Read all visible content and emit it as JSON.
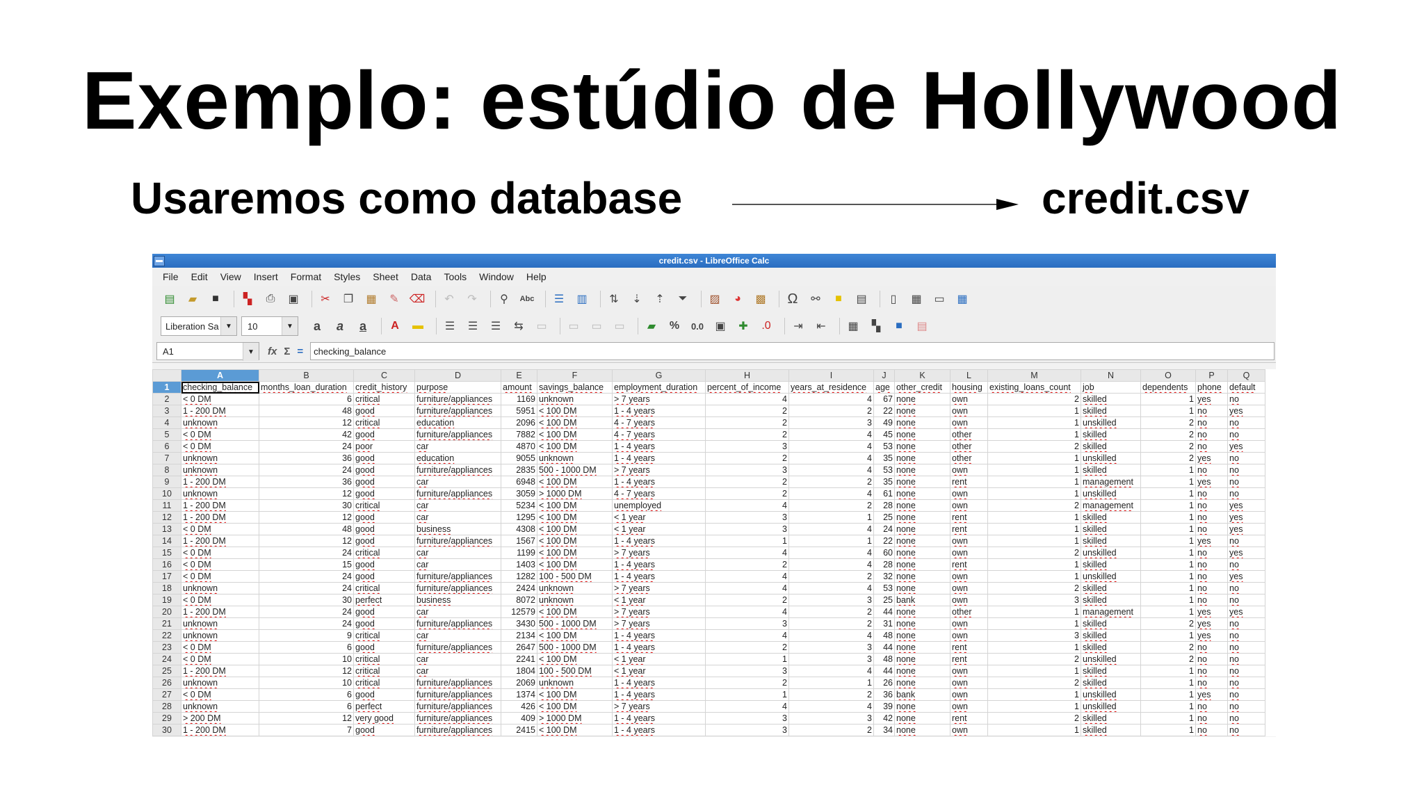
{
  "slide": {
    "title": "Exemplo: estúdio de Hollywood",
    "subtitle_left": "Usaremos como database",
    "subtitle_right": "credit.csv"
  },
  "window": {
    "title": "credit.csv - LibreOffice Calc"
  },
  "menu": [
    "File",
    "Edit",
    "View",
    "Insert",
    "Format",
    "Styles",
    "Sheet",
    "Data",
    "Tools",
    "Window",
    "Help"
  ],
  "toolbar": {
    "font_name": "Liberation Sa",
    "font_size": "10",
    "cell_ref": "A1",
    "formula": "checking_balance",
    "fx_label": "fx"
  },
  "columns": [
    "A",
    "B",
    "C",
    "D",
    "E",
    "F",
    "G",
    "H",
    "I",
    "J",
    "K",
    "L",
    "M",
    "N",
    "O",
    "P",
    "Q"
  ],
  "headers": [
    "checking_balance",
    "months_loan_duration",
    "credit_history",
    "purpose",
    "amount",
    "savings_balance",
    "employment_duration",
    "percent_of_income",
    "years_at_residence",
    "age",
    "other_credit",
    "housing",
    "existing_loans_count",
    "job",
    "dependents",
    "phone",
    "default"
  ],
  "rows": [
    [
      "< 0 DM",
      "6",
      "critical",
      "furniture/appliances",
      "1169",
      "unknown",
      "> 7 years",
      "4",
      "4",
      "67",
      "none",
      "own",
      "2",
      "skilled",
      "1",
      "yes",
      "no"
    ],
    [
      "1 - 200 DM",
      "48",
      "good",
      "furniture/appliances",
      "5951",
      "< 100 DM",
      "1 - 4 years",
      "2",
      "2",
      "22",
      "none",
      "own",
      "1",
      "skilled",
      "1",
      "no",
      "yes"
    ],
    [
      "unknown",
      "12",
      "critical",
      "education",
      "2096",
      "< 100 DM",
      "4 - 7 years",
      "2",
      "3",
      "49",
      "none",
      "own",
      "1",
      "unskilled",
      "2",
      "no",
      "no"
    ],
    [
      "< 0 DM",
      "42",
      "good",
      "furniture/appliances",
      "7882",
      "< 100 DM",
      "4 - 7 years",
      "2",
      "4",
      "45",
      "none",
      "other",
      "1",
      "skilled",
      "2",
      "no",
      "no"
    ],
    [
      "< 0 DM",
      "24",
      "poor",
      "car",
      "4870",
      "< 100 DM",
      "1 - 4 years",
      "3",
      "4",
      "53",
      "none",
      "other",
      "2",
      "skilled",
      "2",
      "no",
      "yes"
    ],
    [
      "unknown",
      "36",
      "good",
      "education",
      "9055",
      "unknown",
      "1 - 4 years",
      "2",
      "4",
      "35",
      "none",
      "other",
      "1",
      "unskilled",
      "2",
      "yes",
      "no"
    ],
    [
      "unknown",
      "24",
      "good",
      "furniture/appliances",
      "2835",
      "500 - 1000 DM",
      "> 7 years",
      "3",
      "4",
      "53",
      "none",
      "own",
      "1",
      "skilled",
      "1",
      "no",
      "no"
    ],
    [
      "1 - 200 DM",
      "36",
      "good",
      "car",
      "6948",
      "< 100 DM",
      "1 - 4 years",
      "2",
      "2",
      "35",
      "none",
      "rent",
      "1",
      "management",
      "1",
      "yes",
      "no"
    ],
    [
      "unknown",
      "12",
      "good",
      "furniture/appliances",
      "3059",
      "> 1000 DM",
      "4 - 7 years",
      "2",
      "4",
      "61",
      "none",
      "own",
      "1",
      "unskilled",
      "1",
      "no",
      "no"
    ],
    [
      "1 - 200 DM",
      "30",
      "critical",
      "car",
      "5234",
      "< 100 DM",
      "unemployed",
      "4",
      "2",
      "28",
      "none",
      "own",
      "2",
      "management",
      "1",
      "no",
      "yes"
    ],
    [
      "1 - 200 DM",
      "12",
      "good",
      "car",
      "1295",
      "< 100 DM",
      "< 1 year",
      "3",
      "1",
      "25",
      "none",
      "rent",
      "1",
      "skilled",
      "1",
      "no",
      "yes"
    ],
    [
      "< 0 DM",
      "48",
      "good",
      "business",
      "4308",
      "< 100 DM",
      "< 1 year",
      "3",
      "4",
      "24",
      "none",
      "rent",
      "1",
      "skilled",
      "1",
      "no",
      "yes"
    ],
    [
      "1 - 200 DM",
      "12",
      "good",
      "furniture/appliances",
      "1567",
      "< 100 DM",
      "1 - 4 years",
      "1",
      "1",
      "22",
      "none",
      "own",
      "1",
      "skilled",
      "1",
      "yes",
      "no"
    ],
    [
      "< 0 DM",
      "24",
      "critical",
      "car",
      "1199",
      "< 100 DM",
      "> 7 years",
      "4",
      "4",
      "60",
      "none",
      "own",
      "2",
      "unskilled",
      "1",
      "no",
      "yes"
    ],
    [
      "< 0 DM",
      "15",
      "good",
      "car",
      "1403",
      "< 100 DM",
      "1 - 4 years",
      "2",
      "4",
      "28",
      "none",
      "rent",
      "1",
      "skilled",
      "1",
      "no",
      "no"
    ],
    [
      "< 0 DM",
      "24",
      "good",
      "furniture/appliances",
      "1282",
      "100 - 500 DM",
      "1 - 4 years",
      "4",
      "2",
      "32",
      "none",
      "own",
      "1",
      "unskilled",
      "1",
      "no",
      "yes"
    ],
    [
      "unknown",
      "24",
      "critical",
      "furniture/appliances",
      "2424",
      "unknown",
      "> 7 years",
      "4",
      "4",
      "53",
      "none",
      "own",
      "2",
      "skilled",
      "1",
      "no",
      "no"
    ],
    [
      "< 0 DM",
      "30",
      "perfect",
      "business",
      "8072",
      "unknown",
      "< 1 year",
      "2",
      "3",
      "25",
      "bank",
      "own",
      "3",
      "skilled",
      "1",
      "no",
      "no"
    ],
    [
      "1 - 200 DM",
      "24",
      "good",
      "car",
      "12579",
      "< 100 DM",
      "> 7 years",
      "4",
      "2",
      "44",
      "none",
      "other",
      "1",
      "management",
      "1",
      "yes",
      "yes"
    ],
    [
      "unknown",
      "24",
      "good",
      "furniture/appliances",
      "3430",
      "500 - 1000 DM",
      "> 7 years",
      "3",
      "2",
      "31",
      "none",
      "own",
      "1",
      "skilled",
      "2",
      "yes",
      "no"
    ],
    [
      "unknown",
      "9",
      "critical",
      "car",
      "2134",
      "< 100 DM",
      "1 - 4 years",
      "4",
      "4",
      "48",
      "none",
      "own",
      "3",
      "skilled",
      "1",
      "yes",
      "no"
    ],
    [
      "< 0 DM",
      "6",
      "good",
      "furniture/appliances",
      "2647",
      "500 - 1000 DM",
      "1 - 4 years",
      "2",
      "3",
      "44",
      "none",
      "rent",
      "1",
      "skilled",
      "2",
      "no",
      "no"
    ],
    [
      "< 0 DM",
      "10",
      "critical",
      "car",
      "2241",
      "< 100 DM",
      "< 1 year",
      "1",
      "3",
      "48",
      "none",
      "rent",
      "2",
      "unskilled",
      "2",
      "no",
      "no"
    ],
    [
      "1 - 200 DM",
      "12",
      "critical",
      "car",
      "1804",
      "100 - 500 DM",
      "< 1 year",
      "3",
      "4",
      "44",
      "none",
      "own",
      "1",
      "skilled",
      "1",
      "no",
      "no"
    ],
    [
      "unknown",
      "10",
      "critical",
      "furniture/appliances",
      "2069",
      "unknown",
      "1 - 4 years",
      "2",
      "1",
      "26",
      "none",
      "own",
      "2",
      "skilled",
      "1",
      "no",
      "no"
    ],
    [
      "< 0 DM",
      "6",
      "good",
      "furniture/appliances",
      "1374",
      "< 100 DM",
      "1 - 4 years",
      "1",
      "2",
      "36",
      "bank",
      "own",
      "1",
      "unskilled",
      "1",
      "yes",
      "no"
    ],
    [
      "unknown",
      "6",
      "perfect",
      "furniture/appliances",
      "426",
      "< 100 DM",
      "> 7 years",
      "4",
      "4",
      "39",
      "none",
      "own",
      "1",
      "unskilled",
      "1",
      "no",
      "no"
    ],
    [
      "> 200 DM",
      "12",
      "very good",
      "furniture/appliances",
      "409",
      "> 1000 DM",
      "1 - 4 years",
      "3",
      "3",
      "42",
      "none",
      "rent",
      "2",
      "skilled",
      "1",
      "no",
      "no"
    ],
    [
      "1 - 200 DM",
      "7",
      "good",
      "furniture/appliances",
      "2415",
      "< 100 DM",
      "1 - 4 years",
      "3",
      "2",
      "34",
      "none",
      "own",
      "1",
      "skilled",
      "1",
      "no",
      "no"
    ]
  ]
}
